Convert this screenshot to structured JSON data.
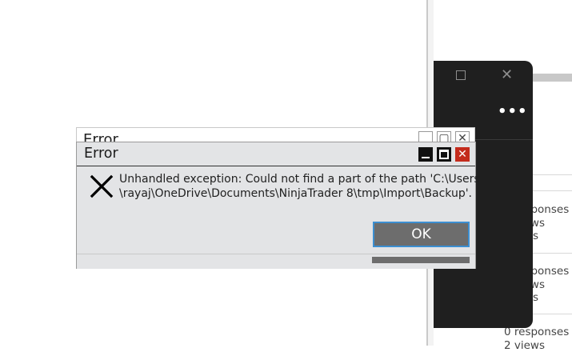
{
  "background_window": {
    "more_label": "•••",
    "stats": [
      {
        "line1": "0 responses",
        "line2": "2 views",
        "line3": "0 likes"
      },
      {
        "line1": "0 responses",
        "line2": "2 views",
        "line3": "0 likes"
      },
      {
        "line1": "0 responses",
        "line2": "2 views",
        "line3": ""
      }
    ]
  },
  "ghost_dialog": {
    "title": "Error"
  },
  "dialog": {
    "title": "Error",
    "message_line1": "Unhandled exception: Could not find a part of the path 'C:\\Users",
    "message_line2": "\\rayaj\\OneDrive\\Documents\\NinjaTrader 8\\tmp\\Import\\Backup'.",
    "ok_label": "OK",
    "progress": 1.0
  },
  "colors": {
    "close_button": "#c42b1c",
    "ok_border": "#3c8fd2",
    "dark_panel": "#1f1f1f"
  }
}
